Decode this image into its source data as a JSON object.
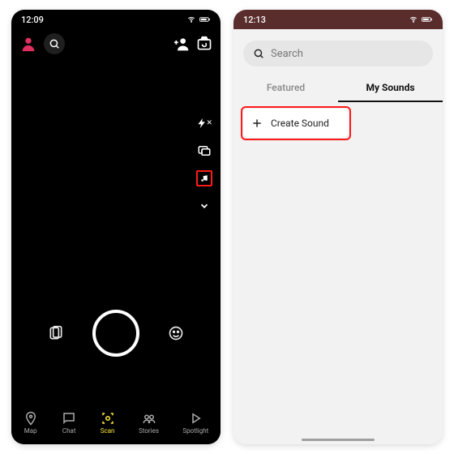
{
  "left": {
    "status": {
      "time": "12:09"
    },
    "nav": {
      "map": "Map",
      "chat": "Chat",
      "scan": "Scan",
      "stories": "Stories",
      "spotlight": "Spotlight"
    }
  },
  "right": {
    "status": {
      "time": "12:13"
    },
    "search": {
      "placeholder": "Search"
    },
    "tabs": {
      "featured": "Featured",
      "mysounds": "My Sounds"
    },
    "create": {
      "label": "Create Sound"
    }
  }
}
